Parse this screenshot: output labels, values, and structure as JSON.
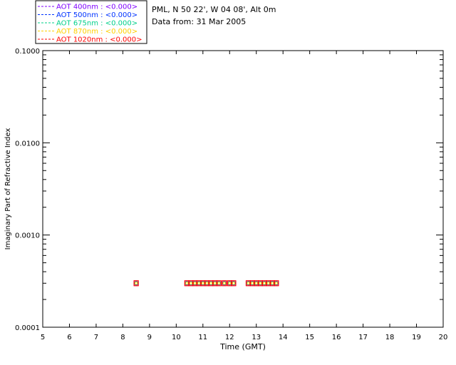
{
  "chart_data": {
    "type": "scatter",
    "title_lines": [
      "PML, N 50 22', W 04 08', Alt 0m",
      "Data from: 31 Mar 2005"
    ],
    "xlabel": "Time (GMT)",
    "ylabel": "Imaginary Part of Refractive Index",
    "xlim": [
      5,
      20
    ],
    "ylim": [
      0.0001,
      0.1
    ],
    "yscale": "log",
    "x_ticks": [
      "5",
      "6",
      "7",
      "8",
      "9",
      "10",
      "11",
      "12",
      "13",
      "14",
      "15",
      "16",
      "17",
      "18",
      "19",
      "20"
    ],
    "y_ticks": [
      "0.0001",
      "0.0010",
      "0.0100",
      "0.1000"
    ],
    "legend_position": "top-left, outside plot",
    "series": [
      {
        "name": "AOT  400nm : <0.000>",
        "color": "#7f00ff",
        "values": [
          0.0003,
          0.0003,
          0.0003,
          0.0003,
          0.0003,
          0.0003,
          0.0003,
          0.0003,
          0.0003,
          0.0003,
          0.0003,
          0.0003,
          0.0003,
          0.0003,
          0.0003,
          0.0003,
          0.0003,
          0.0003,
          0.0003,
          0.0003,
          0.0003
        ]
      },
      {
        "name": "AOT  500nm : <0.000>",
        "color": "#0033ff",
        "values": [
          0.0003,
          0.0003,
          0.0003,
          0.0003,
          0.0003,
          0.0003,
          0.0003,
          0.0003,
          0.0003,
          0.0003,
          0.0003,
          0.0003,
          0.0003,
          0.0003,
          0.0003,
          0.0003,
          0.0003,
          0.0003,
          0.0003,
          0.0003,
          0.0003
        ]
      },
      {
        "name": "AOT  675nm : <0.000>",
        "color": "#00d08a",
        "values": [
          0.0003,
          0.0003,
          0.0003,
          0.0003,
          0.0003,
          0.0003,
          0.0003,
          0.0003,
          0.0003,
          0.0003,
          0.0003,
          0.0003,
          0.0003,
          0.0003,
          0.0003,
          0.0003,
          0.0003,
          0.0003,
          0.0003,
          0.0003,
          0.0003
        ]
      },
      {
        "name": "AOT  870nm : <0.000>",
        "color": "#ffd000",
        "values": [
          0.0003,
          0.0003,
          0.0003,
          0.0003,
          0.0003,
          0.0003,
          0.0003,
          0.0003,
          0.0003,
          0.0003,
          0.0003,
          0.0003,
          0.0003,
          0.0003,
          0.0003,
          0.0003,
          0.0003,
          0.0003,
          0.0003,
          0.0003,
          0.0003
        ]
      },
      {
        "name": "AOT 1020nm : <0.000>",
        "color": "#ff0000",
        "values": [
          0.0003,
          0.0003,
          0.0003,
          0.0003,
          0.0003,
          0.0003,
          0.0003,
          0.0003,
          0.0003,
          0.0003,
          0.0003,
          0.0003,
          0.0003,
          0.0003,
          0.0003,
          0.0003,
          0.0003,
          0.0003,
          0.0003,
          0.0003,
          0.0003
        ]
      }
    ],
    "x": [
      8.5,
      10.4,
      10.55,
      10.7,
      10.85,
      11.0,
      11.15,
      11.3,
      11.45,
      11.6,
      11.8,
      12.0,
      12.15,
      12.7,
      12.85,
      13.0,
      13.15,
      13.3,
      13.45,
      13.6,
      13.75
    ]
  }
}
